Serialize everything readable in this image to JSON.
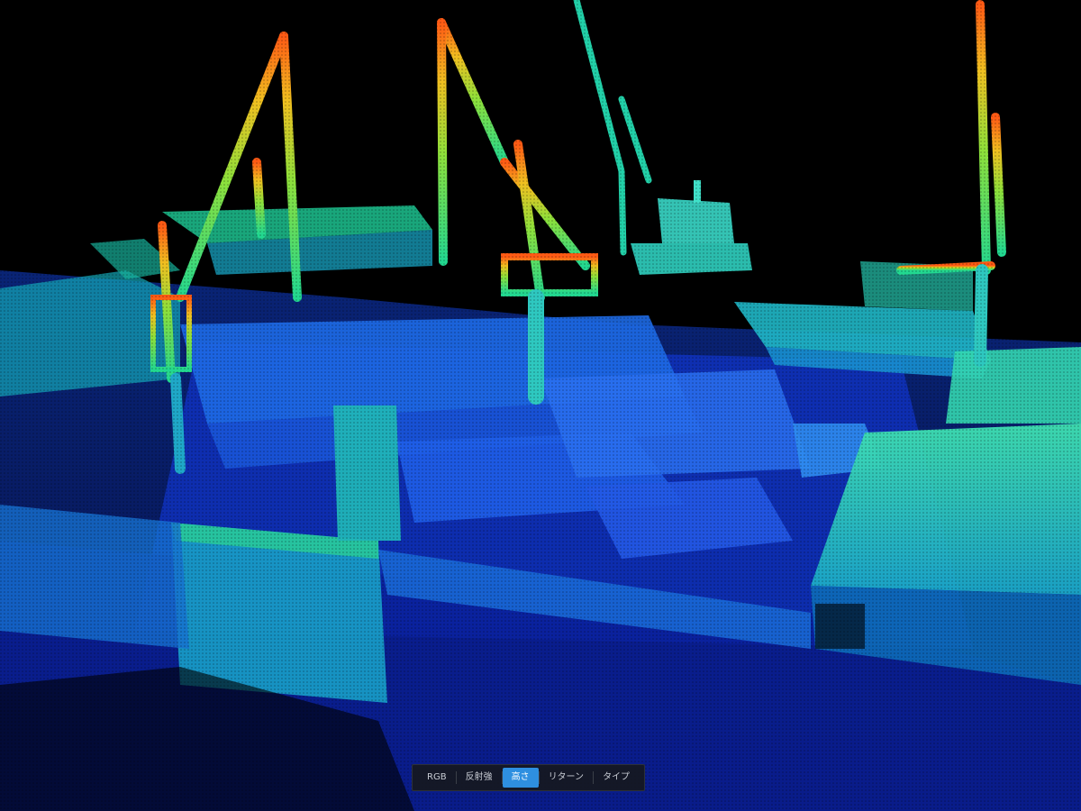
{
  "viewer": {
    "background_color": "#000000",
    "colormap": [
      "#1a3aff",
      "#1f7dff",
      "#19c3e0",
      "#22d890",
      "#8ee03a",
      "#f0c020",
      "#ff5a14"
    ]
  },
  "toolbar": {
    "modes": [
      {
        "label": "RGB",
        "active": false
      },
      {
        "label": "反射強",
        "active": false
      },
      {
        "label": "高さ",
        "active": true
      },
      {
        "label": "リターン",
        "active": false
      },
      {
        "label": "タイプ",
        "active": false
      }
    ],
    "active_color": "#2e8fe0"
  }
}
